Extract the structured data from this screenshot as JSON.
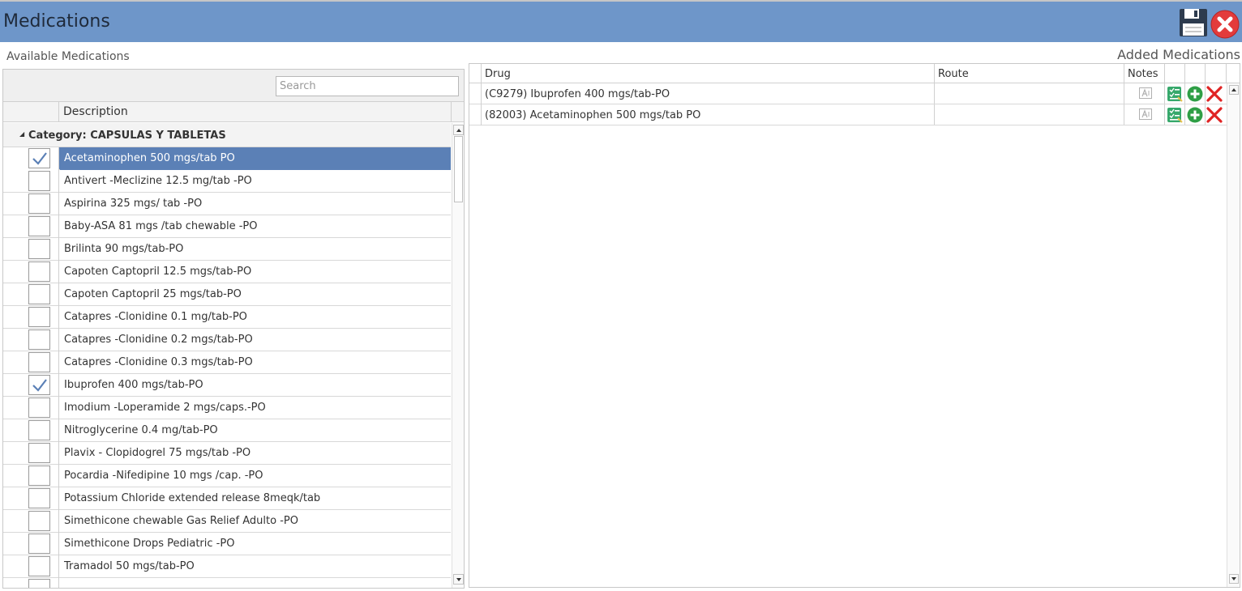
{
  "window": {
    "title": "Medications",
    "save_icon": "floppy-disk-icon",
    "close_icon": "red-circle-x-icon"
  },
  "available": {
    "label": "Available Medications",
    "search_placeholder": "Search",
    "search_value": "",
    "columns": {
      "description": "Description"
    },
    "group_label": "Category: CAPSULAS Y TABLETAS",
    "rows": [
      {
        "label": "Acetaminophen 500 mgs/tab PO",
        "checked": true,
        "selected": true
      },
      {
        "label": "Antivert -Meclizine 12.5 mg/tab -PO",
        "checked": false
      },
      {
        "label": "Aspirina 325 mgs/ tab -PO",
        "checked": false
      },
      {
        "label": "Baby-ASA 81 mgs /tab chewable -PO",
        "checked": false
      },
      {
        "label": "Brilinta 90 mgs/tab-PO",
        "checked": false
      },
      {
        "label": "Capoten Captopril 12.5 mgs/tab-PO",
        "checked": false
      },
      {
        "label": "Capoten Captopril 25 mgs/tab-PO",
        "checked": false
      },
      {
        "label": "Catapres -Clonidine 0.1 mg/tab-PO",
        "checked": false
      },
      {
        "label": "Catapres -Clonidine 0.2 mgs/tab-PO",
        "checked": false
      },
      {
        "label": "Catapres -Clonidine 0.3 mgs/tab-PO",
        "checked": false
      },
      {
        "label": "Ibuprofen 400 mgs/tab-PO",
        "checked": true
      },
      {
        "label": "Imodium -Loperamide 2 mgs/caps.-PO",
        "checked": false
      },
      {
        "label": "Nitroglycerine 0.4 mg/tab-PO",
        "checked": false
      },
      {
        "label": "Plavix - Clopidogrel 75 mgs/tab -PO",
        "checked": false
      },
      {
        "label": "Pocardia -Nifedipine 10 mgs /cap. -PO",
        "checked": false
      },
      {
        "label": "Potassium Chloride extended release 8meqk/tab",
        "checked": false
      },
      {
        "label": "Simethicone chewable Gas Relief Adulto -PO",
        "checked": false
      },
      {
        "label": "Simethicone Drops Pediatric -PO",
        "checked": false
      },
      {
        "label": "Tramadol 50 mgs/tab-PO",
        "checked": false
      },
      {
        "label": "",
        "checked": false
      }
    ]
  },
  "added": {
    "label": "Added Medications",
    "columns": {
      "drug": "Drug",
      "route": "Route",
      "notes": "Notes"
    },
    "rows": [
      {
        "drug": "(C9279) Ibuprofen 400 mgs/tab-PO",
        "route": ""
      },
      {
        "drug": "(82003) Acetaminophen 500 mgs/tab  PO",
        "route": ""
      }
    ],
    "row_icons": [
      "notes-icon",
      "edit-checklist-icon",
      "add-circle-icon",
      "delete-x-icon"
    ]
  },
  "colors": {
    "titlebar": "#6e96c9",
    "selected_row": "#5b80b6",
    "check": "#5b80b6",
    "add_green": "#2e9e45",
    "delete_red": "#e02424"
  }
}
